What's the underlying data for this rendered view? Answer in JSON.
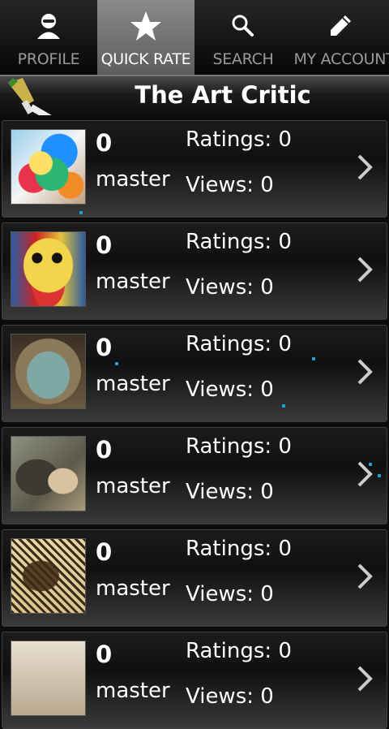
{
  "tabs": [
    {
      "label": "PROFILE",
      "icon": "profile-icon",
      "active": false
    },
    {
      "label": "QUICK RATE",
      "icon": "star-icon",
      "active": true
    },
    {
      "label": "SEARCH",
      "icon": "search-icon",
      "active": false
    },
    {
      "label": "MY ACCOUNT",
      "icon": "pencil-icon",
      "active": false
    }
  ],
  "header": {
    "title": "The Art Critic"
  },
  "items": [
    {
      "score": "0",
      "user": "master",
      "ratings": "Ratings: 0",
      "views": "Views: 0"
    },
    {
      "score": "0",
      "user": "master",
      "ratings": "Ratings: 0",
      "views": "Views: 0"
    },
    {
      "score": "0",
      "user": "master",
      "ratings": "Ratings: 0",
      "views": "Views: 0"
    },
    {
      "score": "0",
      "user": "master",
      "ratings": "Ratings: 0",
      "views": "Views: 0"
    },
    {
      "score": "0",
      "user": "master",
      "ratings": "Ratings: 0",
      "views": "Views: 0"
    },
    {
      "score": "0",
      "user": "master",
      "ratings": "Ratings: 0",
      "views": "Views: 0"
    }
  ],
  "colors": {
    "accent_dot": "#1aa7d8",
    "active_tab": "#7a7a7a"
  }
}
